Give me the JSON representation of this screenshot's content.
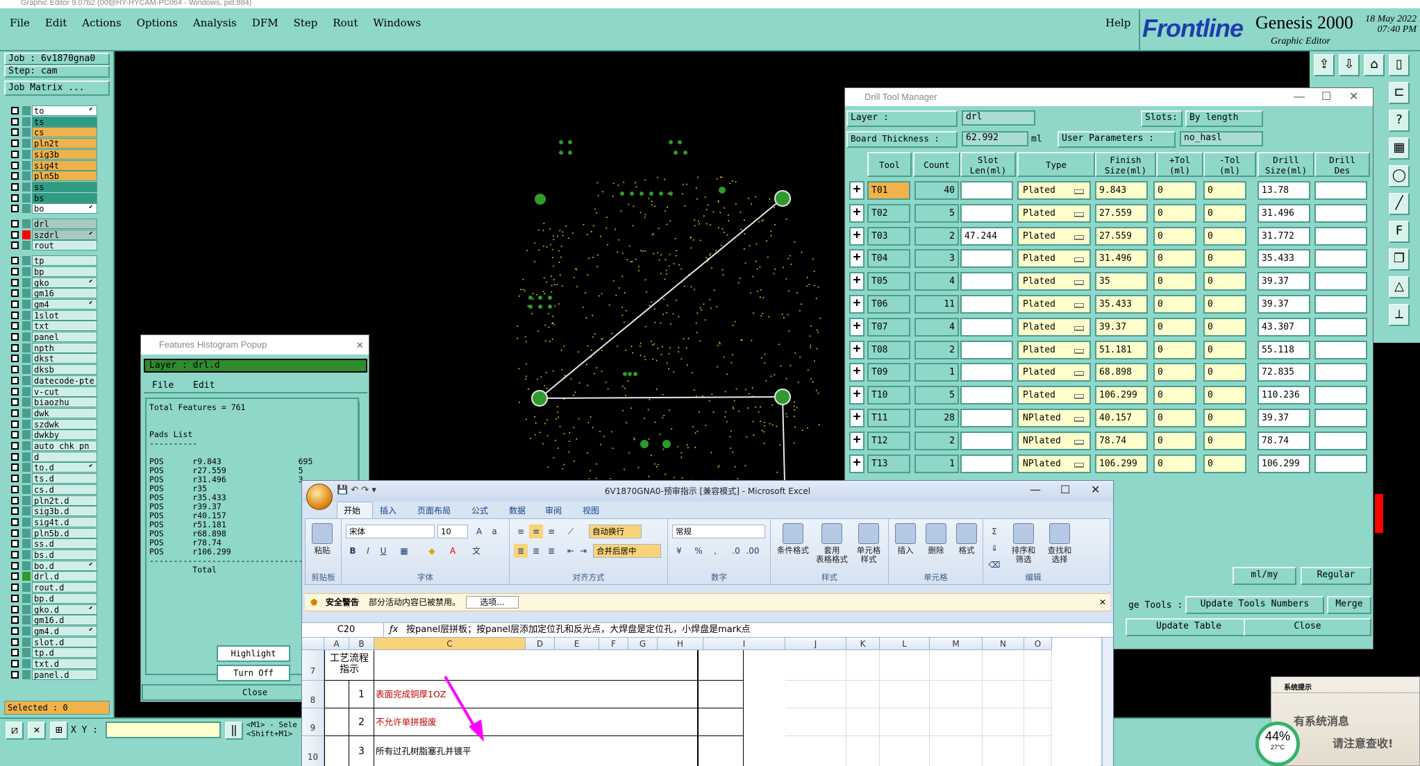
{
  "window_title": "Graphic Editor 9.07b2 (00@HY-HYCAM-PC064 - Windows, pid:884)",
  "menubar": {
    "menus": [
      "File",
      "Edit",
      "Actions",
      "Options",
      "Analysis",
      "DFM",
      "Step",
      "Rout",
      "Windows"
    ],
    "help": "Help"
  },
  "brand": {
    "logo": "Frontline",
    "product": "Genesis 2000",
    "subtitle": "Graphic Editor",
    "date": "18 May 2022",
    "time": "07:40 PM"
  },
  "left_panel": {
    "job": "Job : 6v1870gna0",
    "step": "Step: cam",
    "job_matrix": "Job Matrix ...",
    "selected": "Selected : 0",
    "layers": [
      {
        "name": "to",
        "color": "#ffffff",
        "sq": "#4a9d8f",
        "mark": true
      },
      {
        "name": "ts",
        "color": "#2e9b82",
        "sq": "#4a9d8f"
      },
      {
        "name": "cs",
        "color": "#f0b24b",
        "sq": "#4a9d8f"
      },
      {
        "name": "pln2t",
        "color": "#f0b24b",
        "sq": "#4a9d8f"
      },
      {
        "name": "sig3b",
        "color": "#f0b24b",
        "sq": "#4a9d8f"
      },
      {
        "name": "sig4t",
        "color": "#f0b24b",
        "sq": "#4a9d8f"
      },
      {
        "name": "pln5b",
        "color": "#f0b24b",
        "sq": "#4a9d8f"
      },
      {
        "name": "ss",
        "color": "#2e9b82",
        "sq": "#4a9d8f"
      },
      {
        "name": "bs",
        "color": "#2e9b82",
        "sq": "#4a9d8f"
      },
      {
        "name": "bo",
        "color": "#ffffff",
        "sq": "#4a9d8f",
        "mark": true
      },
      {
        "name": "drl",
        "color": "#a8c8c2",
        "sq": "#4a9d8f",
        "gap": true
      },
      {
        "name": "szdrl",
        "color": "#a8c8c2",
        "sq": "#ff0000",
        "mark": true
      },
      {
        "name": "rout",
        "color": "#cfeee8",
        "sq": "#4a9d8f"
      },
      {
        "name": "tp",
        "color": "#cfeee8",
        "sq": "#4a9d8f",
        "gap": true
      },
      {
        "name": "bp",
        "color": "#cfeee8",
        "sq": "#4a9d8f"
      },
      {
        "name": "gko",
        "color": "#cfeee8",
        "sq": "#4a9d8f",
        "mark": true
      },
      {
        "name": "gm16",
        "color": "#cfeee8",
        "sq": "#4a9d8f"
      },
      {
        "name": "gm4",
        "color": "#cfeee8",
        "sq": "#4a9d8f",
        "mark": true
      },
      {
        "name": "1slot",
        "color": "#cfeee8",
        "sq": "#4a9d8f"
      },
      {
        "name": "txt",
        "color": "#cfeee8",
        "sq": "#4a9d8f"
      },
      {
        "name": "panel",
        "color": "#cfeee8",
        "sq": "#4a9d8f"
      },
      {
        "name": "npth",
        "color": "#cfeee8",
        "sq": "#4a9d8f"
      },
      {
        "name": "dkst",
        "color": "#cfeee8",
        "sq": "#4a9d8f"
      },
      {
        "name": "dksb",
        "color": "#cfeee8",
        "sq": "#4a9d8f"
      },
      {
        "name": "datecode-pte",
        "color": "#cfeee8",
        "sq": "#4a9d8f"
      },
      {
        "name": "v-cut",
        "color": "#cfeee8",
        "sq": "#4a9d8f"
      },
      {
        "name": "biaozhu",
        "color": "#cfeee8",
        "sq": "#4a9d8f"
      },
      {
        "name": "dwk",
        "color": "#cfeee8",
        "sq": "#4a9d8f"
      },
      {
        "name": "szdwk",
        "color": "#cfeee8",
        "sq": "#4a9d8f"
      },
      {
        "name": "dwkby",
        "color": "#cfeee8",
        "sq": "#4a9d8f"
      },
      {
        "name": "auto_chk_pn",
        "color": "#cfeee8",
        "sq": "#4a9d8f"
      },
      {
        "name": "d",
        "color": "#cfeee8",
        "sq": "#4a9d8f"
      },
      {
        "name": "to.d",
        "color": "#cfeee8",
        "sq": "#4a9d8f",
        "mark": true
      },
      {
        "name": "ts.d",
        "color": "#cfeee8",
        "sq": "#4a9d8f"
      },
      {
        "name": "cs.d",
        "color": "#cfeee8",
        "sq": "#4a9d8f"
      },
      {
        "name": "pln2t.d",
        "color": "#cfeee8",
        "sq": "#4a9d8f"
      },
      {
        "name": "sig3b.d",
        "color": "#cfeee8",
        "sq": "#4a9d8f"
      },
      {
        "name": "sig4t.d",
        "color": "#cfeee8",
        "sq": "#4a9d8f"
      },
      {
        "name": "pln5b.d",
        "color": "#cfeee8",
        "sq": "#4a9d8f"
      },
      {
        "name": "ss.d",
        "color": "#cfeee8",
        "sq": "#4a9d8f"
      },
      {
        "name": "bs.d",
        "color": "#cfeee8",
        "sq": "#4a9d8f"
      },
      {
        "name": "bo.d",
        "color": "#cfeee8",
        "sq": "#4a9d8f",
        "mark": true
      },
      {
        "name": "drl.d",
        "color": "#cfeee8",
        "sq": "#2e9b2e"
      },
      {
        "name": "rout.d",
        "color": "#cfeee8",
        "sq": "#4a9d8f"
      },
      {
        "name": "bp.d",
        "color": "#cfeee8",
        "sq": "#4a9d8f"
      },
      {
        "name": "gko.d",
        "color": "#cfeee8",
        "sq": "#4a9d8f",
        "mark": true
      },
      {
        "name": "gm16.d",
        "color": "#cfeee8",
        "sq": "#4a9d8f"
      },
      {
        "name": "gm4.d",
        "color": "#cfeee8",
        "sq": "#4a9d8f",
        "mark": true
      },
      {
        "name": "slot.d",
        "color": "#cfeee8",
        "sq": "#4a9d8f"
      },
      {
        "name": "tp.d",
        "color": "#cfeee8",
        "sq": "#4a9d8f"
      },
      {
        "name": "txt.d",
        "color": "#cfeee8",
        "sq": "#4a9d8f"
      },
      {
        "name": "panel.d",
        "color": "#cfeee8",
        "sq": "#4a9d8f"
      }
    ]
  },
  "status": {
    "xy_label": "X Y :",
    "hint_line1": "<M1> - Sele",
    "hint_line2": "<Shift+M1>"
  },
  "histogram": {
    "title": "Features Histogram Popup",
    "layer": "Layer :  drl.d",
    "menu_file": "File",
    "menu_edit": "Edit",
    "total": "Total Features = 761",
    "pads_header": "Pads List",
    "rows": [
      [
        "POS",
        "r9.843",
        "695"
      ],
      [
        "POS",
        "r27.559",
        "5"
      ],
      [
        "POS",
        "r31.496",
        "3"
      ],
      [
        "POS",
        "r35",
        ""
      ],
      [
        "POS",
        "r35.433",
        ""
      ],
      [
        "POS",
        "r39.37",
        ""
      ],
      [
        "POS",
        "r40.157",
        ""
      ],
      [
        "POS",
        "r51.181",
        ""
      ],
      [
        "POS",
        "r68.898",
        ""
      ],
      [
        "POS",
        "r78.74",
        ""
      ],
      [
        "POS",
        "r106.299",
        ""
      ]
    ],
    "total_label": "Total",
    "btn_highlight": "Highlight",
    "btn_turnoff": "Turn Off",
    "btn_close": "Close"
  },
  "drill_tool_manager": {
    "title": "Drill Tool Manager",
    "layer_label": "Layer          :",
    "layer_value": "drl",
    "slots_label": "Slots:",
    "slots_value": "By length",
    "thickness_label": "Board Thickness :",
    "thickness_value": "62.992",
    "thickness_unit": "ml",
    "user_params_label": "User Parameters :",
    "user_params_value": "no_hasl",
    "headers": [
      "Tool",
      "Count",
      "Slot\nLen(ml)",
      "Type",
      "Finish\nSize(ml)",
      "+Tol\n(ml)",
      "-Tol\n(ml)",
      "Drill\nSize(ml)",
      "Drill\nDes"
    ],
    "rows": [
      {
        "tool": "T01",
        "count": "40",
        "slot": "",
        "type": "Plated",
        "finish": "9.843",
        "ptol": "0",
        "mtol": "0",
        "dsize": "13.78",
        "des": "",
        "sel": true
      },
      {
        "tool": "T02",
        "count": "5",
        "slot": "",
        "type": "Plated",
        "finish": "27.559",
        "ptol": "0",
        "mtol": "0",
        "dsize": "31.496",
        "des": ""
      },
      {
        "tool": "T03",
        "count": "2",
        "slot": "47.244",
        "type": "Plated",
        "finish": "27.559",
        "ptol": "0",
        "mtol": "0",
        "dsize": "31.772",
        "des": ""
      },
      {
        "tool": "T04",
        "count": "3",
        "slot": "",
        "type": "Plated",
        "finish": "31.496",
        "ptol": "0",
        "mtol": "0",
        "dsize": "35.433",
        "des": ""
      },
      {
        "tool": "T05",
        "count": "4",
        "slot": "",
        "type": "Plated",
        "finish": "35",
        "ptol": "0",
        "mtol": "0",
        "dsize": "39.37",
        "des": ""
      },
      {
        "tool": "T06",
        "count": "11",
        "slot": "",
        "type": "Plated",
        "finish": "35.433",
        "ptol": "0",
        "mtol": "0",
        "dsize": "39.37",
        "des": ""
      },
      {
        "tool": "T07",
        "count": "4",
        "slot": "",
        "type": "Plated",
        "finish": "39.37",
        "ptol": "0",
        "mtol": "0",
        "dsize": "43.307",
        "des": ""
      },
      {
        "tool": "T08",
        "count": "2",
        "slot": "",
        "type": "Plated",
        "finish": "51.181",
        "ptol": "0",
        "mtol": "0",
        "dsize": "55.118",
        "des": ""
      },
      {
        "tool": "T09",
        "count": "1",
        "slot": "",
        "type": "Plated",
        "finish": "68.898",
        "ptol": "0",
        "mtol": "0",
        "dsize": "72.835",
        "des": ""
      },
      {
        "tool": "T10",
        "count": "5",
        "slot": "",
        "type": "Plated",
        "finish": "106.299",
        "ptol": "0",
        "mtol": "0",
        "dsize": "110.236",
        "des": ""
      },
      {
        "tool": "T11",
        "count": "28",
        "slot": "",
        "type": "NPlated",
        "finish": "40.157",
        "ptol": "0",
        "mtol": "0",
        "dsize": "39.37",
        "des": ""
      },
      {
        "tool": "T12",
        "count": "2",
        "slot": "",
        "type": "NPlated",
        "finish": "78.74",
        "ptol": "0",
        "mtol": "0",
        "dsize": "78.74",
        "des": ""
      },
      {
        "tool": "T13",
        "count": "1",
        "slot": "",
        "type": "NPlated",
        "finish": "106.299",
        "ptol": "0",
        "mtol": "0",
        "dsize": "106.299",
        "des": ""
      }
    ],
    "units_value": "ml/my",
    "mode_value": "Regular",
    "tools_label": "ge Tools :",
    "update_numbers": "Update Tools Numbers",
    "merge": "Merge",
    "update_table": "Update Table",
    "close": "Close"
  },
  "excel": {
    "title": "6V1870GNA0-预审指示  [兼容模式] - Microsoft Excel",
    "tabs": [
      "开始",
      "插入",
      "页面布局",
      "公式",
      "数据",
      "审阅",
      "视图"
    ],
    "font_name": "宋体",
    "font_size": "10",
    "wrap_text": "自动换行",
    "merge_center": "合并后居中",
    "number_format": "常规",
    "group_clipboard": "剪贴板",
    "group_font": "字体",
    "group_align": "对齐方式",
    "group_number": "数字",
    "group_styles": "样式",
    "group_cells": "单元格",
    "group_edit": "编辑",
    "paste": "粘贴",
    "cond_format": "条件格式",
    "table_format": "套用\n表格格式",
    "cell_style": "单元格\n样式",
    "insert": "插入",
    "delete": "删除",
    "format": "格式",
    "sort_filter": "排序和\n筛选",
    "find_select": "查找和\n选择",
    "security_title": "安全警告",
    "security_text": "部分活动内容已被禁用。",
    "options_btn": "选项...",
    "cell_ref": "C20",
    "formula": "按panel层拼板；按panel层添加定位孔和反光点，大焊盘是定位孔，小焊盘是mark点",
    "columns": [
      "A",
      "B",
      "C",
      "D",
      "E",
      "F",
      "G",
      "H",
      "I",
      "J",
      "K",
      "L",
      "M",
      "N",
      "O"
    ],
    "row7_label": "工艺流程\n指示",
    "row_nums": [
      "7",
      "8",
      "9",
      "10"
    ],
    "items": [
      {
        "num": "1",
        "text": "表面完成铜厚1OZ",
        "color": "#c00000"
      },
      {
        "num": "2",
        "text": "不允许单拼报废",
        "color": "#c00000"
      },
      {
        "num": "3",
        "text": "所有过孔树脂塞孔并镀平",
        "color": "#000000"
      }
    ]
  },
  "notification": {
    "title": "系统提示",
    "line1": "有系统消息",
    "line2": "请注意查收!",
    "gauge_pct": "44%",
    "gauge_temp": "27°C"
  }
}
